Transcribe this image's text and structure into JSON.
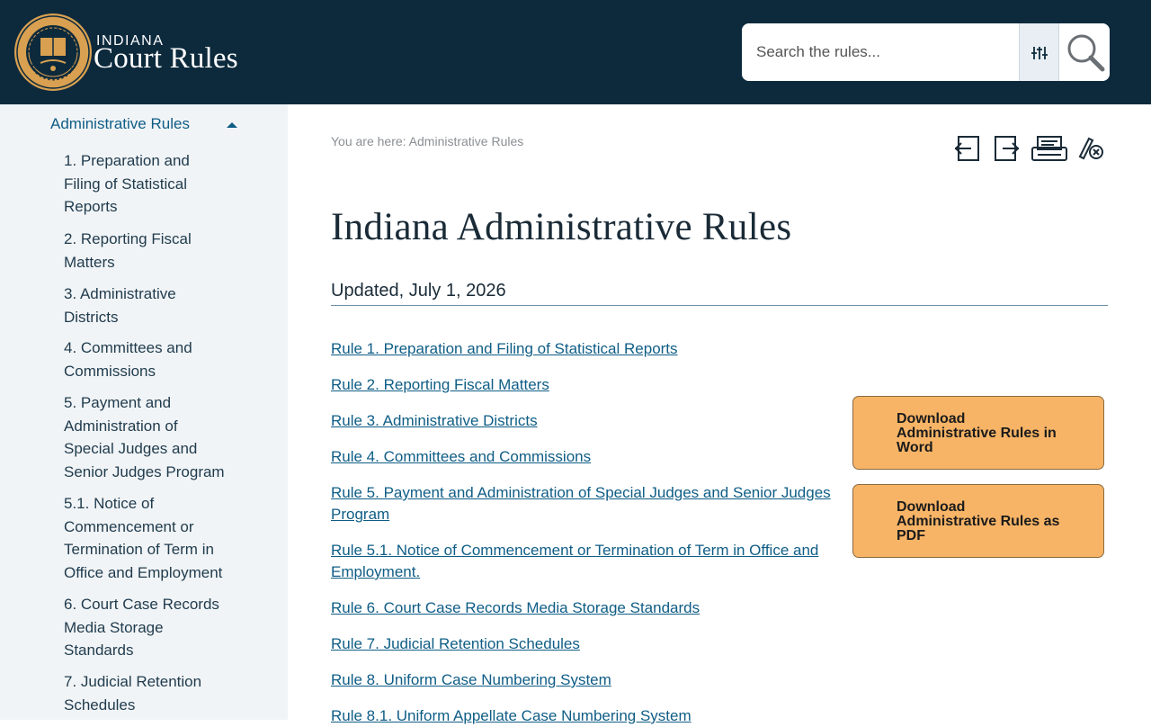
{
  "header": {
    "logo_top": "INDIANA",
    "logo_main": "Court Rules",
    "seal_icon": "indiana-supreme-court-seal",
    "search_placeholder": "Search the rules...",
    "filter_icon": "sliders-icon",
    "search_icon": "magnifier-icon",
    "colors": {
      "bar": "#0d2a3d",
      "seal": "#d8a050"
    }
  },
  "sidebar": {
    "heading": "Administrative Rules",
    "heading_icon": "caret-up-icon",
    "items": [
      {
        "label": "1. Preparation and Filing of Statistical Reports"
      },
      {
        "label": "2. Reporting Fiscal Matters"
      },
      {
        "label": "3. Administrative Districts"
      },
      {
        "label": "4. Committees and Commissions"
      },
      {
        "label": "5. Payment and Administration of Special Judges and Senior Judges Program"
      },
      {
        "label": "5.1. Notice of Commencement or Termination of Term in Office and Employment"
      },
      {
        "label": "6. Court Case Records Media Storage Standards"
      },
      {
        "label": "7. Judicial Retention Schedules"
      }
    ]
  },
  "breadcrumb": "You are here: Administrative Rules",
  "toolbar": {
    "icons": [
      "previous-rule-icon",
      "next-rule-icon",
      "print-icon",
      "clear-highlights-icon"
    ]
  },
  "main": {
    "title": "Indiana Administrative Rules",
    "updated": "Updated, July 1, 2026",
    "links": [
      "Rule 1. Preparation and Filing of Statistical Reports",
      "Rule 2. Reporting Fiscal Matters",
      "Rule 3. Administrative Districts",
      "Rule 4. Committees and Commissions",
      "Rule 5. Payment and Administration of Special Judges and Senior Judges Program",
      "Rule 5.1. Notice of Commencement or Termination of Term in Office and Employment.",
      "Rule 6. Court Case Records Media Storage Standards",
      "Rule 7. Judicial Retention Schedules",
      "Rule 8. Uniform Case Numbering System",
      "Rule 8.1. Uniform Appellate Case Numbering System"
    ],
    "downloads": [
      "Download Administrative Rules in Word",
      "Download Administrative Rules as PDF"
    ],
    "colors": {
      "link": "#0f5d86",
      "download_button": "#f8b466"
    }
  }
}
